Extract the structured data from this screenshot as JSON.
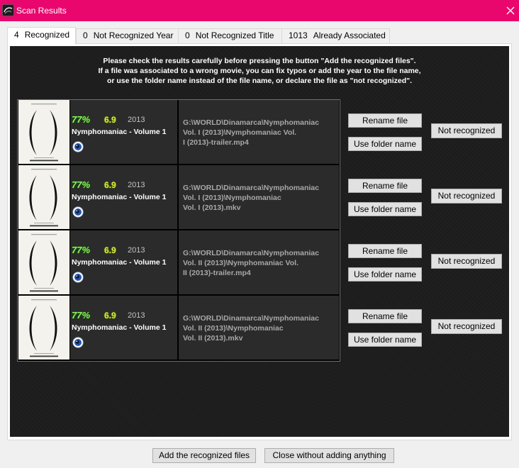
{
  "window": {
    "title": "Scan Results",
    "accent_color": "#e9076e",
    "app_icon": "app-icon",
    "close_icon": "close-icon"
  },
  "tabs": [
    {
      "count": "4",
      "label": "Recognized",
      "selected": true
    },
    {
      "count": "0",
      "label": "Not Recognized Year",
      "selected": false
    },
    {
      "count": "0",
      "label": "Not Recognized Title",
      "selected": false
    },
    {
      "count": "1013",
      "label": "Already Associated",
      "selected": false
    }
  ],
  "instructions": [
    "Please check the results carefully before pressing the button \"Add the recognized files\".",
    "If a file was associated to a wrong movie, you can fix typos or add the year to the file name,",
    "or use the folder name instead of the file name, or declare the file as \"not recognized\"."
  ],
  "colors": {
    "panel": "#1c1c1c",
    "match": "#8ef06a",
    "rating": "#dfe64a",
    "year": "#c4c4c4",
    "path": "#a8a8a8"
  },
  "results": [
    {
      "match": "77%",
      "rating": "6.9",
      "year": "2013",
      "title": "Nymphomaniac - Volume 1",
      "details_icon": "eye-icon",
      "path_lines": [
        "G:\\WORLD\\Dinamarca\\Nymphomaniac",
        "Vol. I (2013)\\Nymphomaniac Vol.",
        "I (2013)-trailer.mp4"
      ],
      "rename_label": "Rename file",
      "folder_label": "Use folder name",
      "not_recognized_label": "Not recognized"
    },
    {
      "match": "77%",
      "rating": "6.9",
      "year": "2013",
      "title": "Nymphomaniac - Volume 1",
      "details_icon": "eye-icon",
      "path_lines": [
        "G:\\WORLD\\Dinamarca\\Nymphomaniac",
        "Vol. I (2013)\\Nymphomaniac",
        "Vol. I (2013).mkv"
      ],
      "rename_label": "Rename file",
      "folder_label": "Use folder name",
      "not_recognized_label": "Not recognized"
    },
    {
      "match": "77%",
      "rating": "6.9",
      "year": "2013",
      "title": "Nymphomaniac - Volume 1",
      "details_icon": "eye-icon",
      "path_lines": [
        "G:\\WORLD\\Dinamarca\\Nymphomaniac",
        "Vol. II (2013)\\Nymphomaniac Vol.",
        "II (2013)-trailer.mp4"
      ],
      "rename_label": "Rename file",
      "folder_label": "Use folder name",
      "not_recognized_label": "Not recognized"
    },
    {
      "match": "77%",
      "rating": "6.9",
      "year": "2013",
      "title": "Nymphomaniac - Volume 1",
      "details_icon": "eye-icon",
      "path_lines": [
        "G:\\WORLD\\Dinamarca\\Nymphomaniac",
        "Vol. II (2013)\\Nymphomaniac",
        "Vol. II (2013).mkv"
      ],
      "rename_label": "Rename file",
      "folder_label": "Use folder name",
      "not_recognized_label": "Not recognized"
    }
  ],
  "footer": {
    "add_label": "Add the recognized files",
    "close_label": "Close without adding anything"
  }
}
